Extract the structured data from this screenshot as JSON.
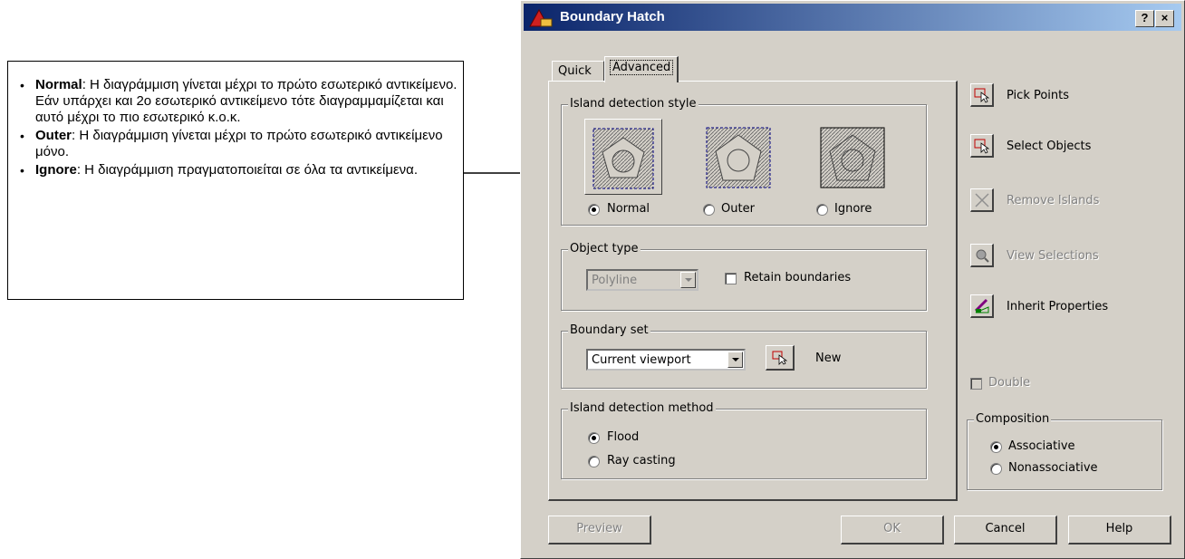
{
  "note": {
    "items": [
      {
        "term": "Normal",
        "text": ": Η διαγράμμιση γίνεται μέχρι το πρώτο εσωτερικό αντικείμενο. Εάν υπάρχει και 2ο εσωτερικό αντικείμενο τότε διαγραμμαμίζεται και αυτό μέχρι το πιο εσωτερικό κ.ο.κ."
      },
      {
        "term": "Outer",
        "text": ": Η διαγράμμιση γίνεται μέχρι το πρώτο εσωτερικό αντικείμενο μόνο."
      },
      {
        "term": "Ignore",
        "text": ": Η διαγράμμιση πραγματοποιείται σε όλα τα αντικείμενα."
      }
    ]
  },
  "dialog": {
    "title": "Boundary Hatch",
    "help_glyph": "?",
    "close_glyph": "×",
    "tabs": [
      {
        "label": "Quick",
        "active": false
      },
      {
        "label": "Advanced",
        "active": true
      }
    ],
    "island_style": {
      "group_label": "Island detection style",
      "options": [
        {
          "label": "Normal",
          "selected": true
        },
        {
          "label": "Outer",
          "selected": false
        },
        {
          "label": "Ignore",
          "selected": false
        }
      ]
    },
    "object_type": {
      "group_label": "Object type",
      "combo_value": "Polyline",
      "retain_label": "Retain boundaries",
      "retain_checked": false
    },
    "boundary_set": {
      "group_label": "Boundary set",
      "combo_value": "Current viewport",
      "new_label": "New"
    },
    "island_method": {
      "group_label": "Island detection method",
      "options": [
        {
          "label": "Flood",
          "selected": true
        },
        {
          "label": "Ray casting",
          "selected": false
        }
      ]
    },
    "side_buttons": [
      {
        "label": "Pick Points",
        "icon": "pick-points-icon",
        "enabled": true
      },
      {
        "label": "Select Objects",
        "icon": "select-objects-icon",
        "enabled": true
      },
      {
        "label": "Remove Islands",
        "icon": "remove-islands-icon",
        "enabled": false
      },
      {
        "label": "View Selections",
        "icon": "view-selections-icon",
        "enabled": false
      },
      {
        "label": "Inherit Properties",
        "icon": "inherit-properties-icon",
        "enabled": true
      }
    ],
    "double_label": "Double",
    "composition": {
      "group_label": "Composition",
      "options": [
        {
          "label": "Associative",
          "selected": true
        },
        {
          "label": "Nonassociative",
          "selected": false
        }
      ]
    },
    "buttons": {
      "preview": "Preview",
      "ok": "OK",
      "cancel": "Cancel",
      "help": "Help"
    }
  }
}
